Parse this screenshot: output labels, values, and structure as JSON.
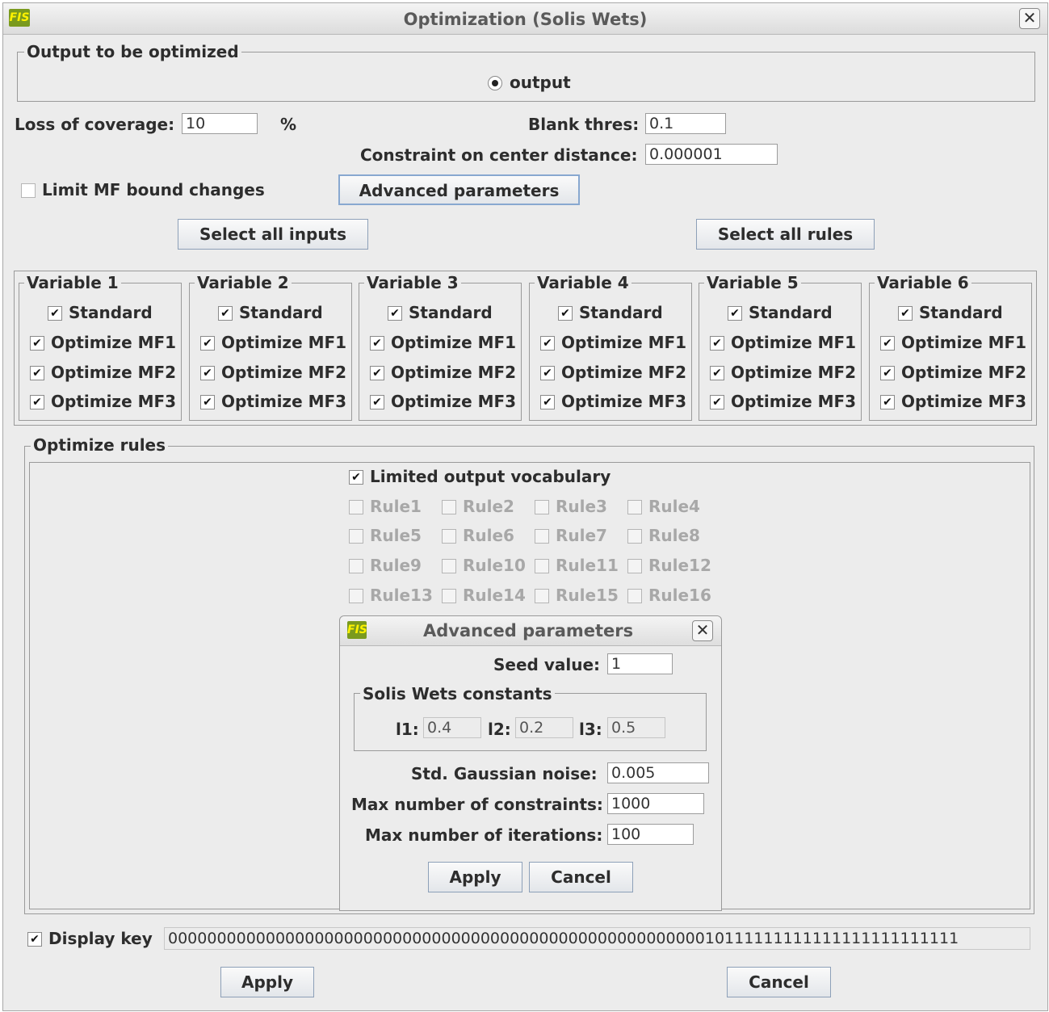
{
  "window": {
    "title": "Optimization (Solis Wets)",
    "app_icon": "FIS",
    "close_glyph": "✕"
  },
  "output_group": {
    "legend": "Output to be optimized",
    "radio_label": "output"
  },
  "params": {
    "loss_label": "Loss of coverage:",
    "loss_value": "10",
    "loss_unit": "%",
    "blank_label": "Blank thres:",
    "blank_value": "0.1",
    "center_label": "Constraint on center distance:",
    "center_value": "0.000001"
  },
  "limit_mf": {
    "label": "Limit MF bound changes",
    "checked": false
  },
  "buttons": {
    "advanced": "Advanced parameters",
    "select_inputs": "Select all inputs",
    "select_rules": "Select all rules",
    "apply": "Apply",
    "cancel": "Cancel"
  },
  "variables": [
    {
      "legend": "Variable 1",
      "standard": "Standard",
      "mf1": "Optimize MF1",
      "mf2": "Optimize MF2",
      "mf3": "Optimize MF3"
    },
    {
      "legend": "Variable 2",
      "standard": "Standard",
      "mf1": "Optimize MF1",
      "mf2": "Optimize MF2",
      "mf3": "Optimize MF3"
    },
    {
      "legend": "Variable 3",
      "standard": "Standard",
      "mf1": "Optimize MF1",
      "mf2": "Optimize MF2",
      "mf3": "Optimize MF3"
    },
    {
      "legend": "Variable 4",
      "standard": "Standard",
      "mf1": "Optimize MF1",
      "mf2": "Optimize MF2",
      "mf3": "Optimize MF3"
    },
    {
      "legend": "Variable 5",
      "standard": "Standard",
      "mf1": "Optimize MF1",
      "mf2": "Optimize MF2",
      "mf3": "Optimize MF3"
    },
    {
      "legend": "Variable 6",
      "standard": "Standard",
      "mf1": "Optimize MF1",
      "mf2": "Optimize MF2",
      "mf3": "Optimize MF3"
    }
  ],
  "rules_group": {
    "legend": "Optimize rules",
    "limited_vocab": "Limited output vocabulary",
    "rules": [
      "Rule1",
      "Rule2",
      "Rule3",
      "Rule4",
      "Rule5",
      "Rule6",
      "Rule7",
      "Rule8",
      "Rule9",
      "Rule10",
      "Rule11",
      "Rule12",
      "Rule13",
      "Rule14",
      "Rule15",
      "Rule16"
    ]
  },
  "advanced_dialog": {
    "title": "Advanced parameters",
    "seed_label": "Seed value:",
    "seed_value": "1",
    "solis_legend": "Solis Wets constants",
    "l1_label": "l1:",
    "l1_value": "0.4",
    "l2_label": "l2:",
    "l2_value": "0.2",
    "l3_label": "l3:",
    "l3_value": "0.5",
    "noise_label": "Std. Gaussian noise:",
    "noise_value": "0.005",
    "constraints_label": "Max number of constraints:",
    "constraints_value": "1000",
    "iterations_label": "Max number of iterations:",
    "iterations_value": "100",
    "apply": "Apply",
    "cancel": "Cancel"
  },
  "display_key": {
    "label": "Display key",
    "checked": true,
    "value": "000000000000000000000000000000000000000000000000000000010111111111111111111111111"
  },
  "colors": {
    "window_bg": "#ececec",
    "border": "#9a9a9a",
    "button_border": "#8da0b8",
    "disabled_text": "#a8a8a8"
  }
}
